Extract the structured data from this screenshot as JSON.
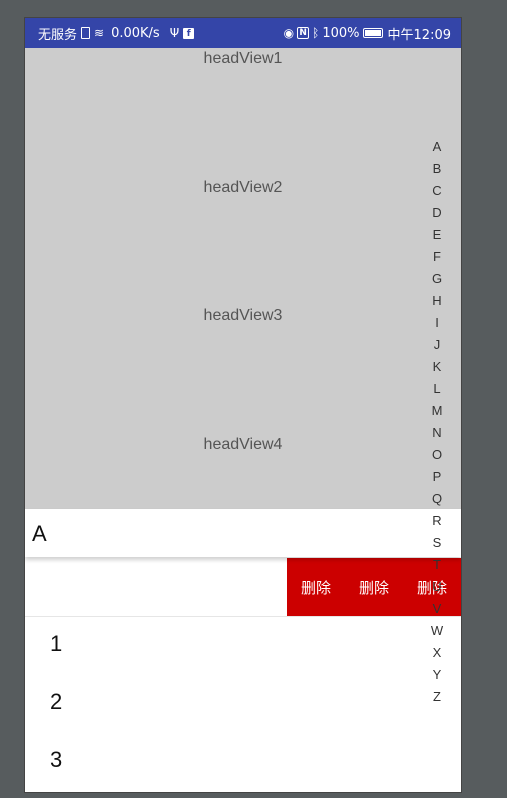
{
  "status_bar": {
    "carrier": "无服务",
    "net_speed": "0.00K/s",
    "battery": "100%",
    "time": "中午12:09"
  },
  "head_views": [
    "headView1",
    "headView2",
    "headView3",
    "headView4"
  ],
  "section": {
    "letter": "A"
  },
  "swipe_row": {
    "actions": [
      "删除",
      "删除",
      "删除"
    ]
  },
  "list_items": [
    "1",
    "2",
    "3"
  ],
  "index_letters": [
    "A",
    "B",
    "C",
    "D",
    "E",
    "F",
    "G",
    "H",
    "I",
    "J",
    "K",
    "L",
    "M",
    "N",
    "O",
    "P",
    "Q",
    "R",
    "S",
    "T",
    "U",
    "V",
    "W",
    "X",
    "Y",
    "Z"
  ],
  "colors": {
    "status_bar": "#3445a8",
    "header_bg": "#cccccc",
    "delete_bg": "#cc0000"
  }
}
